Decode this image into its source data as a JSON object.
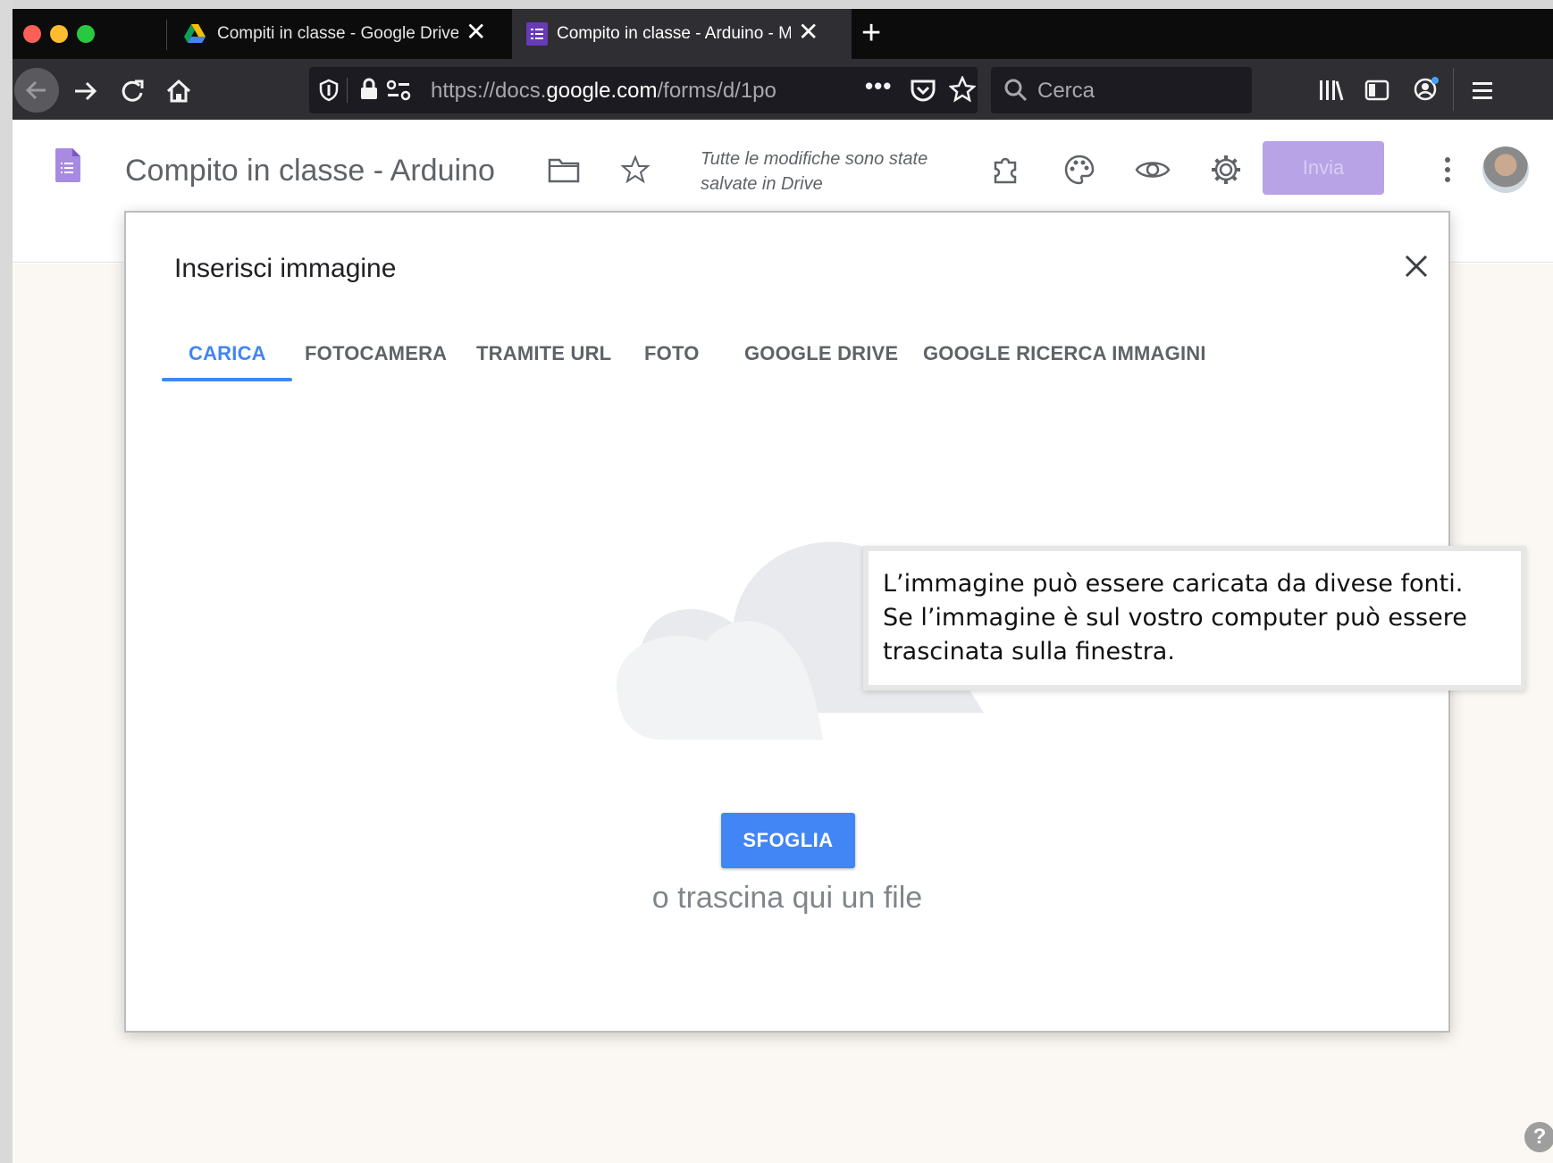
{
  "browser": {
    "tabs": [
      {
        "title": "Compiti in classe - Google Drive",
        "icon": "google-drive-icon",
        "active": false
      },
      {
        "title": "Compito in classe - Arduino - M",
        "icon": "google-forms-icon",
        "active": true
      }
    ],
    "url": {
      "prefix": "https://docs.",
      "domain": "google.com",
      "path": "/forms/d/1po"
    },
    "search_placeholder": "Cerca"
  },
  "form_header": {
    "title": "Compito in classe - Arduino",
    "save_status": "Tutte le modifiche sono state salvate in Drive",
    "send_label": "Invia",
    "accent_color": "#673ab7"
  },
  "dialog": {
    "title": "Inserisci immagine",
    "tabs": [
      "CARICA",
      "FOTOCAMERA",
      "TRAMITE URL",
      "FOTO",
      "GOOGLE DRIVE",
      "GOOGLE RICERCA IMMAGINI"
    ],
    "active_tab": "CARICA",
    "browse_label": "SFOGLIA",
    "drag_text": "o trascina qui un file"
  },
  "callout": {
    "line1": "L’immagine può essere caricata da divese fonti.",
    "line2": "Se l’immagine è sul vostro computer può essere",
    "line3": "trascinata sulla finestra."
  },
  "help_label": "?"
}
